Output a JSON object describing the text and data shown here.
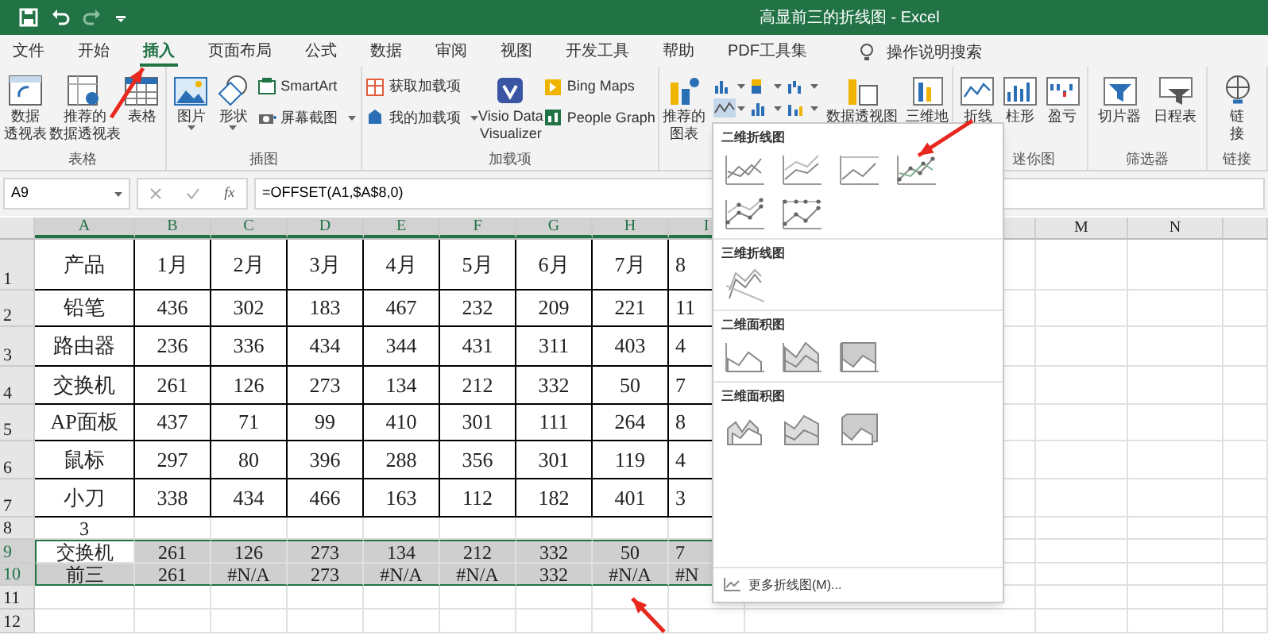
{
  "title_bar": {
    "title": "高显前三的折线图 - Excel"
  },
  "ribbon_tabs": [
    {
      "label": "文件",
      "selected": false
    },
    {
      "label": "开始",
      "selected": false
    },
    {
      "label": "插入",
      "selected": true
    },
    {
      "label": "页面布局",
      "selected": false
    },
    {
      "label": "公式",
      "selected": false
    },
    {
      "label": "数据",
      "selected": false
    },
    {
      "label": "审阅",
      "selected": false
    },
    {
      "label": "视图",
      "selected": false
    },
    {
      "label": "开发工具",
      "selected": false
    },
    {
      "label": "帮助",
      "selected": false
    },
    {
      "label": "PDF工具集",
      "selected": false
    }
  ],
  "tell_me": {
    "label": "操作说明搜索"
  },
  "ribbon_groups": [
    {
      "label": "表格",
      "items": [
        {
          "kind": "large",
          "lines": [
            "数据",
            "透视表"
          ]
        },
        {
          "kind": "large",
          "lines": [
            "推荐的",
            "数据透视表"
          ]
        },
        {
          "kind": "large",
          "lines": [
            "表格"
          ]
        }
      ]
    },
    {
      "label": "插图",
      "items": [
        {
          "kind": "large",
          "lines": [
            "图片"
          ],
          "dropdown": true
        },
        {
          "kind": "large",
          "lines": [
            "形状"
          ],
          "dropdown": true
        },
        {
          "kind": "stack",
          "entries": [
            {
              "label": "SmartArt",
              "dropdown": false
            },
            {
              "label": "屏幕截图",
              "dropdown": true
            }
          ]
        }
      ]
    },
    {
      "label": "加载项",
      "items": [
        {
          "kind": "stack",
          "entries": [
            {
              "label": "获取加载项",
              "dropdown": false
            },
            {
              "label": "我的加载项",
              "dropdown": true
            }
          ]
        },
        {
          "kind": "large",
          "lines": [
            "Visio Data",
            "Visualizer"
          ]
        },
        {
          "kind": "stack",
          "entries": [
            {
              "label": "Bing Maps",
              "dropdown": false
            },
            {
              "label": "People Graph",
              "dropdown": false
            }
          ]
        }
      ]
    },
    {
      "items": [
        {
          "kind": "large",
          "lines": [
            "推荐的",
            "图表"
          ]
        },
        {
          "kind": "chart-grid"
        },
        {
          "kind": "large",
          "lines": [
            "数据透视图"
          ]
        },
        {
          "kind": "large",
          "lines": [
            "三维地"
          ]
        }
      ]
    },
    {
      "label": "迷你图",
      "items": [
        {
          "kind": "large",
          "lines": [
            "折线"
          ]
        },
        {
          "kind": "large",
          "lines": [
            "柱形"
          ]
        },
        {
          "kind": "large",
          "lines": [
            "盈亏"
          ]
        }
      ]
    },
    {
      "label": "筛选器",
      "items": [
        {
          "kind": "large",
          "lines": [
            "切片器"
          ]
        },
        {
          "kind": "large",
          "lines": [
            "日程表"
          ]
        }
      ]
    },
    {
      "label": "链接",
      "items": [
        {
          "kind": "large",
          "lines": [
            "链",
            "接"
          ]
        }
      ]
    }
  ],
  "formula_bar": {
    "name_box": "A9",
    "function_label": "fx",
    "formula": "=OFFSET(A1,$A$8,0)"
  },
  "sheet": {
    "columns": [
      "A",
      "B",
      "C",
      "D",
      "E",
      "F",
      "G",
      "H",
      "I",
      "M",
      "N"
    ],
    "rows": [
      {
        "header": "1",
        "kind": "table",
        "cells": [
          "产品",
          "1月",
          "2月",
          "3月",
          "4月",
          "5月",
          "6月",
          "7月",
          "8"
        ]
      },
      {
        "header": "2",
        "kind": "table",
        "cells": [
          "铅笔",
          "436",
          "302",
          "183",
          "467",
          "232",
          "209",
          "221",
          "11"
        ]
      },
      {
        "header": "3",
        "kind": "table",
        "cells": [
          "路由器",
          "236",
          "336",
          "434",
          "344",
          "431",
          "311",
          "403",
          "4"
        ]
      },
      {
        "header": "4",
        "kind": "table",
        "cells": [
          "交换机",
          "261",
          "126",
          "273",
          "134",
          "212",
          "332",
          "50",
          "7"
        ]
      },
      {
        "header": "5",
        "kind": "table",
        "cells": [
          "AP面板",
          "437",
          "71",
          "99",
          "410",
          "301",
          "111",
          "264",
          "8"
        ]
      },
      {
        "header": "6",
        "kind": "table",
        "cells": [
          "鼠标",
          "297",
          "80",
          "396",
          "288",
          "356",
          "301",
          "119",
          "4"
        ]
      },
      {
        "header": "7",
        "kind": "table",
        "cells": [
          "小刀",
          "338",
          "434",
          "466",
          "163",
          "112",
          "182",
          "401",
          "3"
        ]
      },
      {
        "header": "8",
        "kind": "plain",
        "cells": [
          "3"
        ]
      },
      {
        "header": "9",
        "kind": "selected",
        "active": true,
        "cells": [
          "交换机",
          "261",
          "126",
          "273",
          "134",
          "212",
          "332",
          "50",
          "7"
        ]
      },
      {
        "header": "10",
        "kind": "selected",
        "active": false,
        "cells": [
          "前三",
          "261",
          "#N/A",
          "273",
          "#N/A",
          "#N/A",
          "332",
          "#N/A",
          "#N"
        ]
      },
      {
        "header": "11",
        "kind": "plain",
        "cells": []
      },
      {
        "header": "12",
        "kind": "plain",
        "cells": []
      }
    ]
  },
  "chart_menu": {
    "sections": [
      {
        "title": "二维折线图",
        "items": [
          {
            "kind": "line"
          },
          {
            "kind": "stacked-line"
          },
          {
            "kind": "percent-line"
          },
          {
            "kind": "line-markers"
          },
          {
            "kind": "stacked-line-markers"
          },
          {
            "kind": "percent-line-markers"
          }
        ]
      },
      {
        "title": "三维折线图",
        "items": [
          {
            "kind": "line-3d"
          }
        ]
      },
      {
        "title": "二维面积图",
        "items": [
          {
            "kind": "area"
          },
          {
            "kind": "stacked-area"
          },
          {
            "kind": "percent-area"
          }
        ]
      },
      {
        "title": "三维面积图",
        "items": [
          {
            "kind": "area-3d"
          },
          {
            "kind": "stacked-area-3d"
          },
          {
            "kind": "percent-area-3d"
          }
        ]
      }
    ],
    "more": "更多折线图(M)..."
  }
}
